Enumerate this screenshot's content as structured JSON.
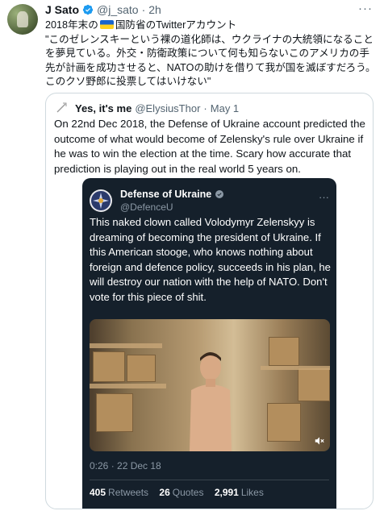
{
  "tweet": {
    "author_name": "J Sato",
    "author_handle": "@j_sato",
    "separator": "·",
    "time": "2h",
    "more": "···",
    "text_prefix": "2018年末の",
    "text_body": "国防省のTwitterアカウント\n\"このゼレンスキーという裸の道化師は、ウクライナの大統領になることを夢見ている。外交・防衛政策について何も知らないこのアメリカの手先が計画を成功させると、NATOの助けを借りて我が国を滅ぼすだろう。このクソ野郎に投票してはいけない\""
  },
  "quote": {
    "author_name": "Yes, it's me",
    "author_handle": "@ElysiusThor",
    "separator": "·",
    "date": "May 1",
    "text": "On 22nd Dec 2018, the Defense of Ukraine account predicted the outcome of what would become of Zelensky's rule over Ukraine if he was to win the election at the time. Scary how accurate that prediction is playing out in the real world 5 years on."
  },
  "embedded": {
    "author_name": "Defense of Ukraine",
    "author_handle": "@DefenceU",
    "more": "···",
    "text": "This naked clown called Volodymyr Zelenskyy is dreaming of becoming the president of Ukraine. If this American stooge, who knows nothing about foreign and defence policy, succeeds in his plan, he will destroy our nation with the help of NATO. Don't vote for this piece of shit.",
    "meta": "0:26 · 22 Dec 18",
    "retweets_count": "405",
    "retweets_label": "Retweets",
    "quotes_count": "26",
    "quotes_label": "Quotes",
    "likes_count": "2,991",
    "likes_label": "Likes"
  },
  "colors": {
    "verified_blue": "#1d9bf0",
    "embed_background": "#15202b",
    "muted_text": "#536471"
  },
  "icons": [
    "verified-badge-icon",
    "ukraine-flag-icon",
    "defence-emblem-icon",
    "mute-icon",
    "more-icon"
  ]
}
